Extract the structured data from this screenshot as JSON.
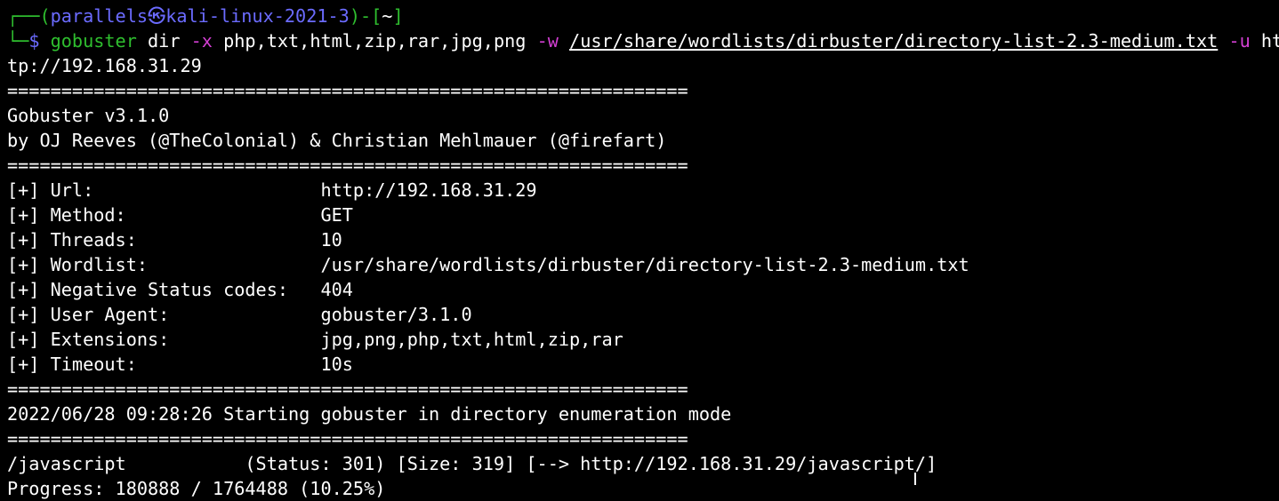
{
  "terminal": {
    "lines": [
      [
        {
          "t": "┌──(",
          "c": "green"
        },
        {
          "t": "parallels㉿kali-linux-2021-3",
          "c": "blue"
        },
        {
          "t": ")-[",
          "c": "green"
        },
        {
          "t": "~",
          "c": "white"
        },
        {
          "t": "]",
          "c": "green"
        }
      ],
      [
        {
          "t": "└─",
          "c": "green"
        },
        {
          "t": "$ ",
          "c": "blue"
        },
        {
          "t": "gobuster",
          "c": "green"
        },
        {
          "t": " dir ",
          "c": "white"
        },
        {
          "t": "-x",
          "c": "magenta"
        },
        {
          "t": " php,txt,html,zip,rar,jpg,png ",
          "c": "white"
        },
        {
          "t": "-w",
          "c": "magenta"
        },
        {
          "t": " ",
          "c": "white"
        },
        {
          "t": "/usr/share/wordlists/dirbuster/directory-list-2.3-medium.txt",
          "c": "white ul"
        },
        {
          "t": " ",
          "c": "white"
        },
        {
          "t": "-u",
          "c": "magenta"
        },
        {
          "t": " ht",
          "c": "white"
        }
      ],
      [
        {
          "t": "tp://192.168.31.29",
          "c": "white"
        }
      ],
      [
        {
          "t": "===============================================================",
          "c": "white"
        }
      ],
      [
        {
          "t": "Gobuster v3.1.0",
          "c": "white"
        }
      ],
      [
        {
          "t": "by OJ Reeves (@TheColonial) & Christian Mehlmauer (@firefart)",
          "c": "white"
        }
      ],
      [
        {
          "t": "===============================================================",
          "c": "white"
        }
      ],
      [
        {
          "t": "[+] Url:                     http://192.168.31.29",
          "c": "white"
        }
      ],
      [
        {
          "t": "[+] Method:                  GET",
          "c": "white"
        }
      ],
      [
        {
          "t": "[+] Threads:                 10",
          "c": "white"
        }
      ],
      [
        {
          "t": "[+] Wordlist:                /usr/share/wordlists/dirbuster/directory-list-2.3-medium.txt",
          "c": "white"
        }
      ],
      [
        {
          "t": "[+] Negative Status codes:   404",
          "c": "white"
        }
      ],
      [
        {
          "t": "[+] User Agent:              gobuster/3.1.0",
          "c": "white"
        }
      ],
      [
        {
          "t": "[+] Extensions:              jpg,png,php,txt,html,zip,rar",
          "c": "white"
        }
      ],
      [
        {
          "t": "[+] Timeout:                 10s",
          "c": "white"
        }
      ],
      [
        {
          "t": "===============================================================",
          "c": "white"
        }
      ],
      [
        {
          "t": "2022/06/28 09:28:26 Starting gobuster in directory enumeration mode",
          "c": "white"
        }
      ],
      [
        {
          "t": "===============================================================",
          "c": "white"
        }
      ],
      [
        {
          "t": "/javascript           (Status: 301) [Size: 319] [--> http://192.168.31.29/javascript/]",
          "c": "white"
        }
      ],
      [
        {
          "t": "Progress: 180888 / 1764488 (10.25%)",
          "c": "white"
        }
      ]
    ]
  }
}
